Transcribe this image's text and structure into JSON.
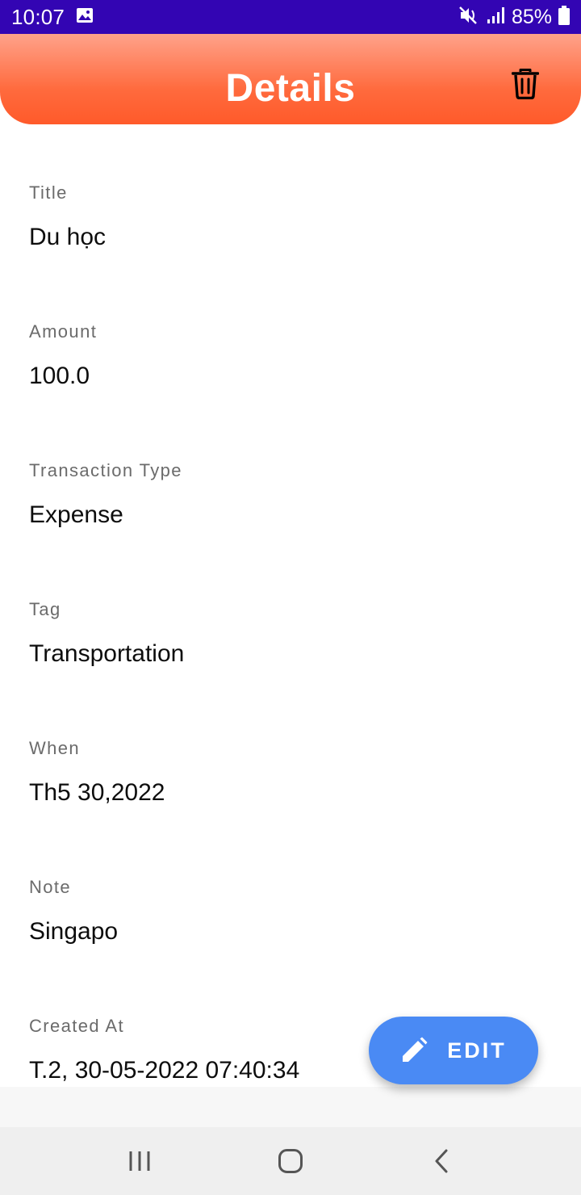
{
  "status_bar": {
    "time": "10:07",
    "battery": "85%",
    "icons": [
      "gallery-notification-icon",
      "vibrate-mute-icon",
      "signal-icon",
      "battery-icon"
    ]
  },
  "header": {
    "title": "Details",
    "delete_icon": "trash-icon",
    "gradient_colors": [
      "#ffa28a",
      "#ff5a2a"
    ]
  },
  "fields": [
    {
      "label": "Title",
      "value": "Du học"
    },
    {
      "label": "Amount",
      "value": "100.0"
    },
    {
      "label": "Transaction Type",
      "value": "Expense"
    },
    {
      "label": "Tag",
      "value": "Transportation"
    },
    {
      "label": "When",
      "value": "Th5 30,2022"
    },
    {
      "label": "Note",
      "value": "Singapo"
    },
    {
      "label": "Created At",
      "value": "T.2, 30-05-2022 07:40:34"
    }
  ],
  "fab": {
    "label": "EDIT",
    "icon": "pencil-icon",
    "color": "#4a8af4"
  },
  "nav_bar": {
    "buttons": [
      "recent-apps-icon",
      "home-icon",
      "back-icon"
    ]
  }
}
